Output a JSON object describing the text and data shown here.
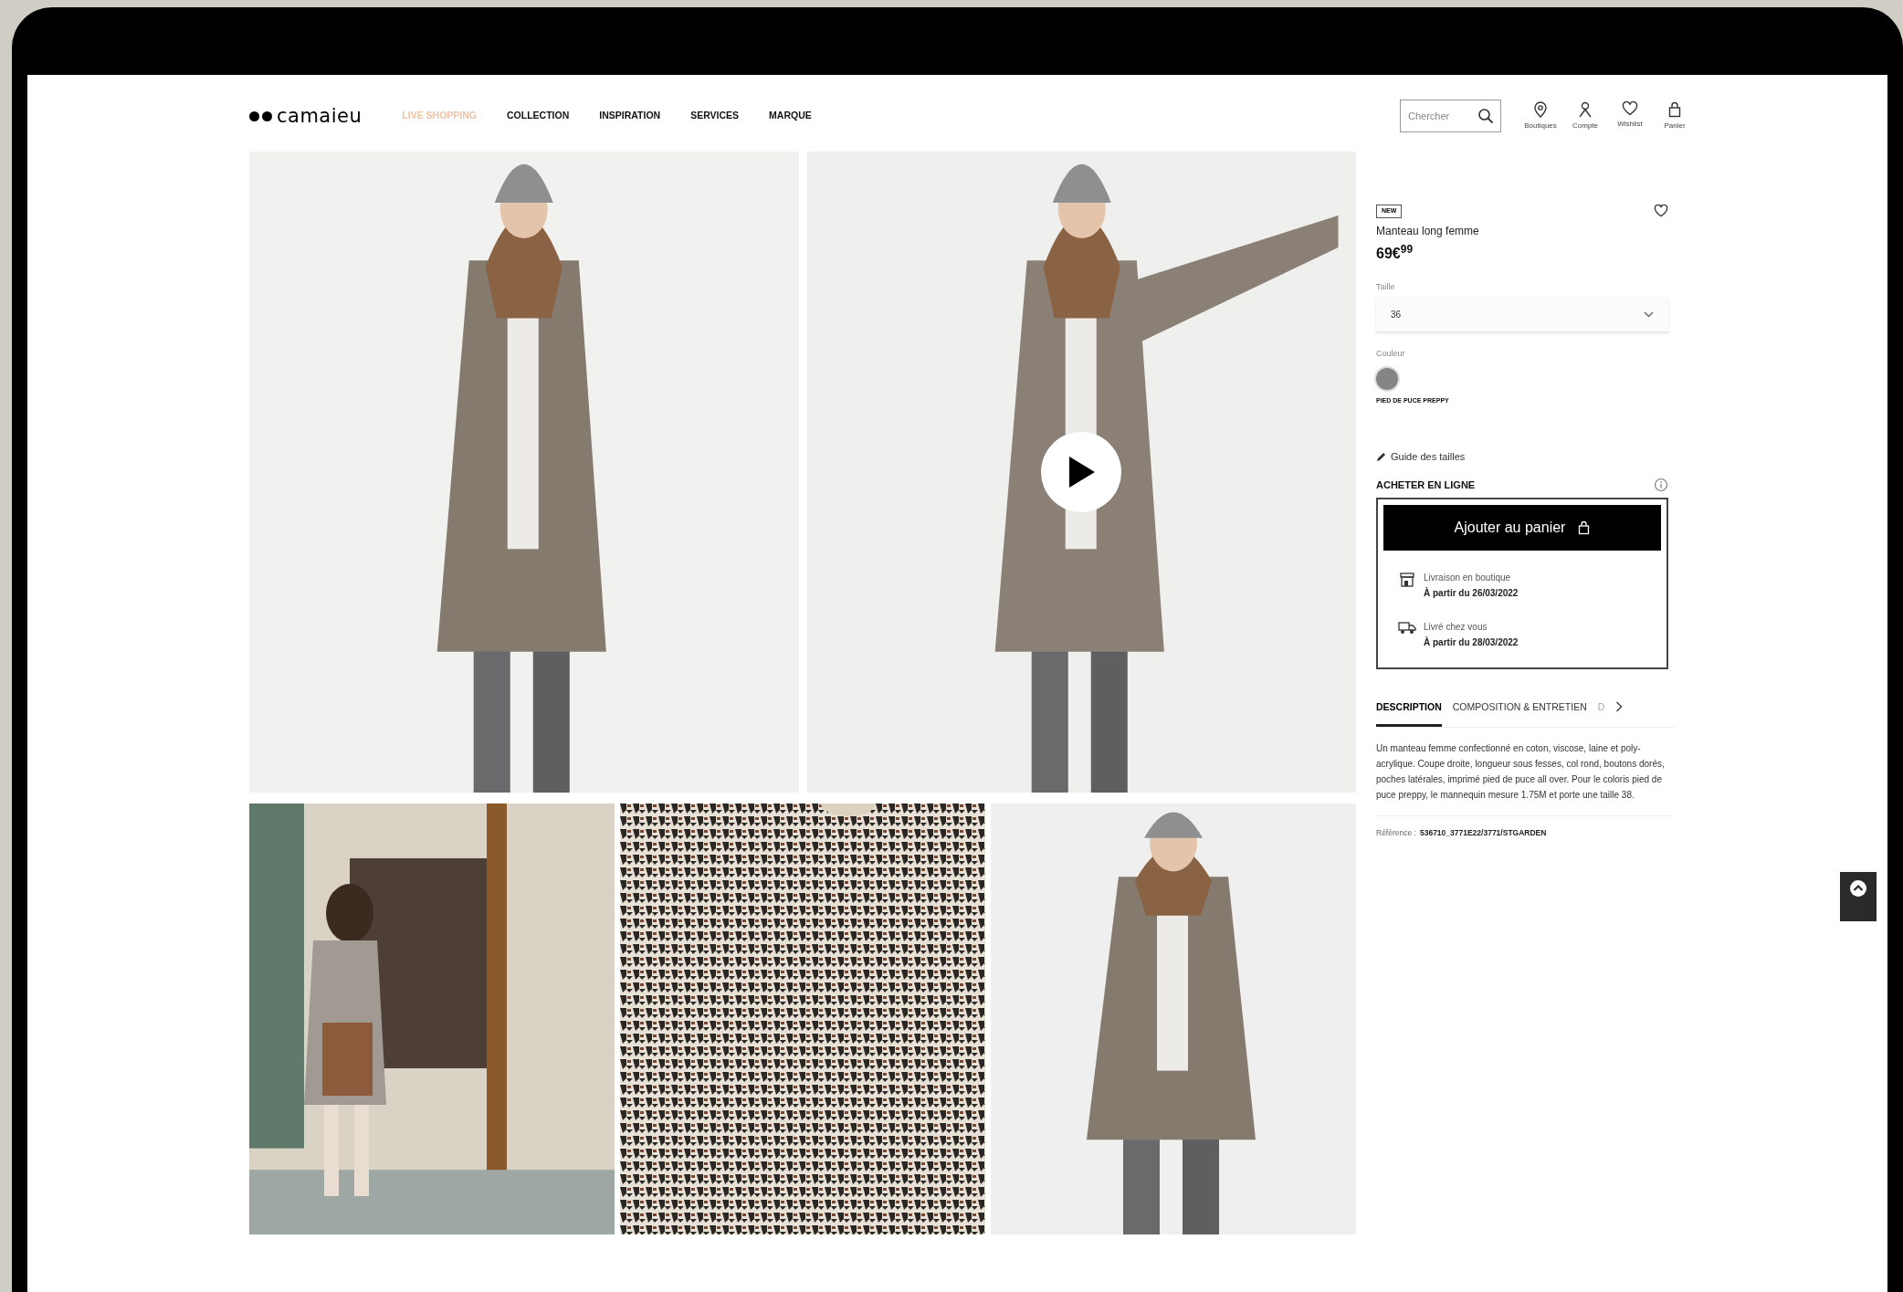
{
  "header": {
    "logo": "camaieu",
    "nav": [
      {
        "label": "LIVE SHOPPING",
        "highlighted": true
      },
      {
        "label": "COLLECTION",
        "highlighted": false
      },
      {
        "label": "INSPIRATION",
        "highlighted": false
      },
      {
        "label": "SERVICES",
        "highlighted": false
      },
      {
        "label": "MARQUE",
        "highlighted": false
      }
    ],
    "search": {
      "placeholder": "Chercher"
    },
    "actions": [
      {
        "kind": "store",
        "label": "Boutiques"
      },
      {
        "kind": "account",
        "label": "Compte"
      },
      {
        "kind": "wishlist",
        "label": "Wishlist"
      },
      {
        "kind": "cart",
        "label": "Panier"
      }
    ]
  },
  "gallery": [
    {
      "kind": "picture",
      "play_button": false
    },
    {
      "kind": "picture",
      "play_button": true
    },
    {
      "kind": "picture",
      "play_button": false
    },
    {
      "kind": "picture",
      "play_button": false
    },
    {
      "kind": "picture",
      "play_button": false
    }
  ],
  "product": {
    "badge": "NEW",
    "title": "Manteau long femme",
    "price": "69€$^{99}$",
    "size_label": "Taille",
    "size_value": "36",
    "color_label": "Couleur",
    "swatches": [
      {
        "color": "#858585",
        "selected": true
      }
    ],
    "color_name": "PIED DE PUCE PREPPY",
    "size_guide": "Guide des tailles",
    "buy_title": "ACHETER EN LIGNE",
    "add_button": "Ajouter au panier",
    "delivery": [
      {
        "kind": "store",
        "title": "Livraison en boutique",
        "date": "À partir du 26/03/2022"
      },
      {
        "kind": "home",
        "title": "Livré chez vous",
        "date": "À partir du 28/03/2022"
      }
    ],
    "tabs": [
      {
        "label": "DESCRIPTION",
        "selected": true
      },
      {
        "label": "COMPOSITION & ENTRETIEN",
        "selected": false
      },
      {
        "label": "D",
        "selected": false
      }
    ],
    "description": "Un manteau femme confectionné en coton, viscose, laine et poly-acrylique. Coupe droite, longueur sous fesses, col rond, boutons dorés, poches latérales, imprimé pied de puce all over. Pour le coloris pied de puce preppy, le mannequin mesure 1.75M et porte une taille 38.",
    "reference_label": "Référence :",
    "reference": "536710_3771E22/3771/STGARDEN"
  }
}
